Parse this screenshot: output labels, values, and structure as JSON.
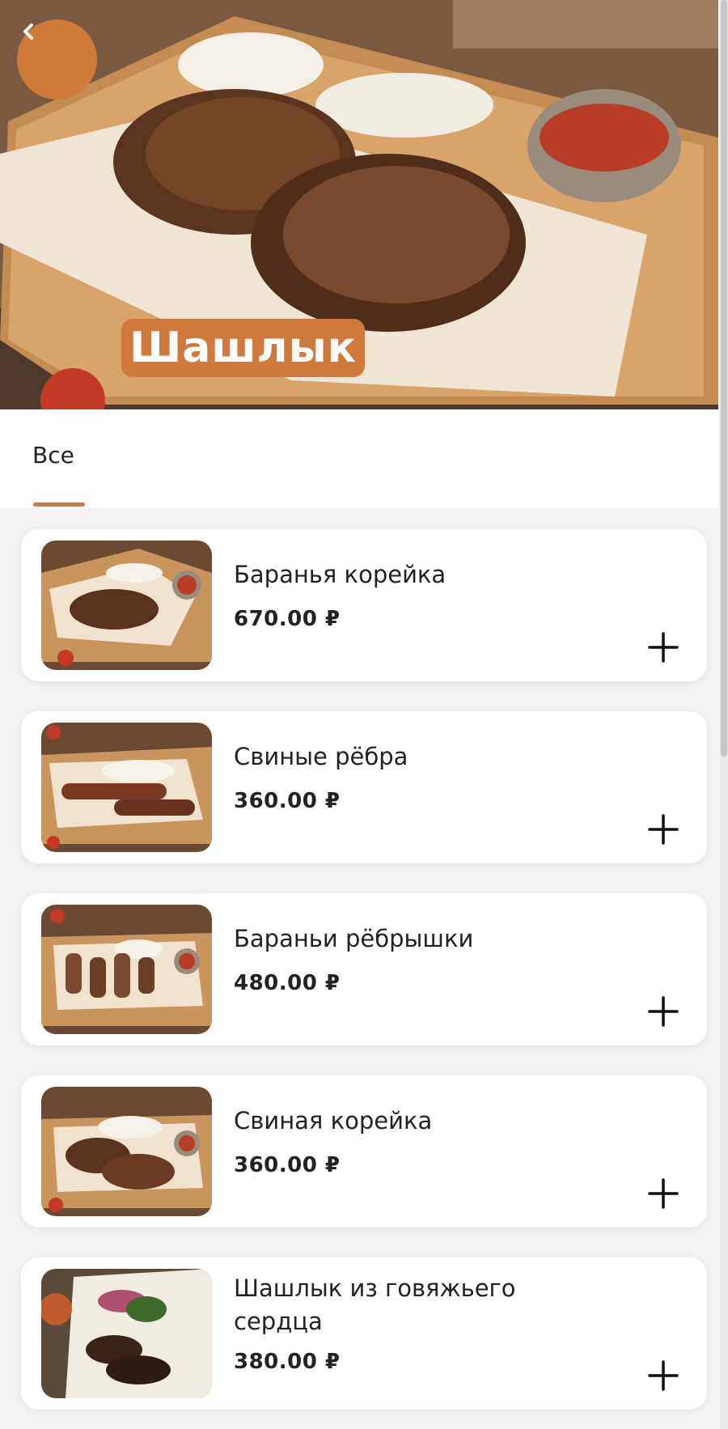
{
  "header": {
    "back_icon": "chevron-left-icon",
    "title": "Шашлык"
  },
  "tabs": [
    {
      "label": "Все",
      "active": true
    }
  ],
  "accent_color": "#d0793c",
  "items": [
    {
      "name": "Баранья корейка",
      "price": "670.00 ₽"
    },
    {
      "name": "Свиные рёбра",
      "price": "360.00 ₽"
    },
    {
      "name": "Бараньи рёбрышки",
      "price": "480.00 ₽"
    },
    {
      "name": "Свиная корейка",
      "price": "360.00 ₽"
    },
    {
      "name": "Шашлык из говяжьего сердца",
      "price": "380.00 ₽"
    }
  ],
  "add_icon": "plus-icon"
}
